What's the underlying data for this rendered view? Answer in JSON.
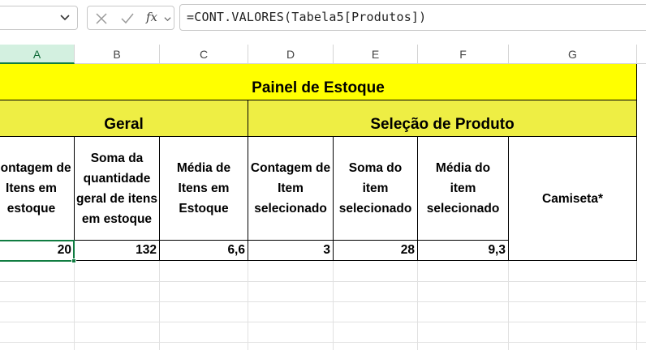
{
  "formula_bar": {
    "formula": "=CONT.VALORES(Tabela5[Produtos])",
    "icons": [
      "chevron-down-icon",
      "cancel-icon",
      "confirm-icon",
      "insert-function-icon"
    ],
    "fx_label": "fx"
  },
  "columns": [
    {
      "letter": "A",
      "active": true
    },
    {
      "letter": "B"
    },
    {
      "letter": "C"
    },
    {
      "letter": "D"
    },
    {
      "letter": "E"
    },
    {
      "letter": "F"
    },
    {
      "letter": "G"
    }
  ],
  "sheet": {
    "title": "Painel de Estoque",
    "group_geral": "Geral",
    "group_selecao": "Seleção de Produto",
    "headers": [
      "Contagem de Itens em estoque",
      "Soma da quantidade geral de itens em estoque",
      "Média de Itens em Estoque",
      "Contagem de Item selecionado",
      "Soma do item selecionado",
      "Média do item selecionado",
      "Camiseta*"
    ],
    "values": [
      "20",
      "132",
      "6,6",
      "3",
      "28",
      "9,3",
      ""
    ]
  },
  "colors": {
    "title_fill": "#ffff00",
    "group_fill": "#eeee44",
    "selection": "#107c41",
    "active_header": "#d3f0e0"
  }
}
